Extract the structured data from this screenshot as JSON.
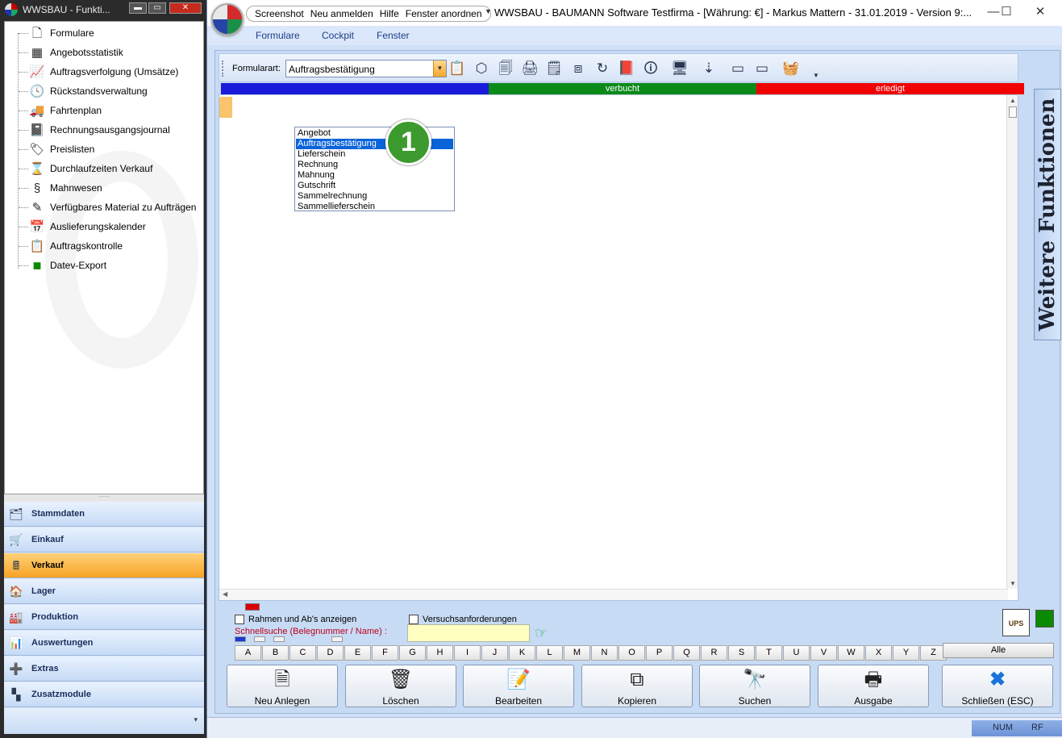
{
  "left_window": {
    "title": "WWSBAU - Funkti...",
    "tree_items": [
      {
        "icon": "document-icon",
        "glyph": "🗋",
        "label": "Formulare"
      },
      {
        "icon": "statistics-table-icon",
        "glyph": "▦",
        "label": "Angebotsstatistik"
      },
      {
        "icon": "sales-chart-icon",
        "glyph": "📈",
        "label": "Auftragsverfolgung (Umsätze)"
      },
      {
        "icon": "clock-back-icon",
        "glyph": "🕓",
        "label": "Rückstandsverwaltung"
      },
      {
        "icon": "truck-icon",
        "glyph": "🚚",
        "label": "Fahrtenplan"
      },
      {
        "icon": "journal-icon",
        "glyph": "📓",
        "label": "Rechnungsausgangsjournal"
      },
      {
        "icon": "price-tag-icon",
        "glyph": "🏷",
        "label": "Preislisten"
      },
      {
        "icon": "hourglass-icon",
        "glyph": "⌛",
        "label": "Durchlaufzeiten Verkauf"
      },
      {
        "icon": "paragraph-icon",
        "glyph": "§",
        "label": "Mahnwesen"
      },
      {
        "icon": "pencil-material-icon",
        "glyph": "✎",
        "label": "Verfügbares Material zu Aufträgen"
      },
      {
        "icon": "calendar-icon",
        "glyph": "📅",
        "label": "Auslieferungskalender"
      },
      {
        "icon": "clipboard-check-icon",
        "glyph": "📋",
        "label": "Auftragskontrolle"
      },
      {
        "icon": "datev-icon",
        "glyph": "■",
        "label": "Datev-Export"
      }
    ],
    "splitter_text": "·····",
    "nav_items": [
      {
        "icon": "master-data-icon",
        "glyph": "🗂",
        "label": "Stammdaten",
        "active": false
      },
      {
        "icon": "cart-icon",
        "glyph": "🛒",
        "label": "Einkauf",
        "active": false
      },
      {
        "icon": "cash-register-icon",
        "glyph": "🖩",
        "label": "Verkauf",
        "active": true
      },
      {
        "icon": "warehouse-icon",
        "glyph": "🏠",
        "label": "Lager",
        "active": false
      },
      {
        "icon": "production-icon",
        "glyph": "🏭",
        "label": "Produktion",
        "active": false
      },
      {
        "icon": "analysis-icon",
        "glyph": "📊",
        "label": "Auswertungen",
        "active": false
      },
      {
        "icon": "extras-icon",
        "glyph": "➕",
        "label": "Extras",
        "active": false
      },
      {
        "icon": "modules-icon",
        "glyph": "▚",
        "label": "Zusatzmodule",
        "active": false
      }
    ],
    "nav_more_glyph": "▾"
  },
  "main_window": {
    "quick_access": [
      "Screenshot",
      "Neu anmelden",
      "Hilfe",
      "Fenster anordnen"
    ],
    "caption": "WWSBAU - BAUMANN Software Testfirma - [Währung: €] -   Markus Mattern - 31.01.2019 - Version 9:...",
    "window_buttons": {
      "minimize": "—",
      "maximize": "☐",
      "close": "✕"
    },
    "menu": [
      "Formulare",
      "Cockpit",
      "Fenster"
    ],
    "toolbar": {
      "label": "Formularart:",
      "selected": "Auftragsbestätigung",
      "icons": [
        "clipboard-icon",
        "box-3d-icon",
        "copy-docs-icon",
        "printer-stack-icon",
        "document-lines-icon",
        "cube-edit-icon",
        "refresh-clock-icon",
        "book-delete-icon",
        "info-doc-icon",
        "monitor-icon",
        "sort-down-icon",
        "page-bottom-icon",
        "page-top-icon",
        "basket-icon"
      ]
    },
    "status_bars": [
      {
        "label": "",
        "color": "#1a1ad8"
      },
      {
        "label": "verbucht",
        "color": "#0b8a1a"
      },
      {
        "label": "erledigt",
        "color": "#f00000"
      }
    ],
    "dropdown_options": [
      "Angebot",
      "Auftragsbestätigung",
      "Lieferschein",
      "Rechnung",
      "Mahnung",
      "Gutschrift",
      "Sammelrechnung",
      "Sammellieferschein"
    ],
    "dropdown_selected_index": 1,
    "badge_number": "1",
    "side_tab": "Weitere Funktionen",
    "checkbox_rahmen": "Rahmen und Ab's anzeigen",
    "checkbox_versuch": "Versuchsanforderungen",
    "search_label": "Schnellsuche (Belegnummer / Name) :",
    "search_value": "",
    "ups_label": "UPS",
    "letters": [
      "A",
      "B",
      "C",
      "D",
      "E",
      "F",
      "G",
      "H",
      "I",
      "J",
      "K",
      "L",
      "M",
      "N",
      "O",
      "P",
      "Q",
      "R",
      "S",
      "T",
      "U",
      "V",
      "W",
      "X",
      "Y",
      "Z"
    ],
    "alle": "Alle",
    "actions": [
      {
        "name": "neu-anlegen-button",
        "icon": "new-document-icon",
        "glyph": "🗎",
        "label": "Neu Anlegen"
      },
      {
        "name": "loeschen-button",
        "icon": "trash-icon",
        "glyph": "🗑",
        "label": "Löschen"
      },
      {
        "name": "bearbeiten-button",
        "icon": "edit-document-icon",
        "glyph": "📝",
        "label": "Bearbeiten"
      },
      {
        "name": "kopieren-button",
        "icon": "copy-icon",
        "glyph": "⧉",
        "label": "Kopieren"
      },
      {
        "name": "suchen-button",
        "icon": "binoculars-icon",
        "glyph": "🔭",
        "label": "Suchen"
      },
      {
        "name": "ausgabe-button",
        "icon": "printer-icon",
        "glyph": "🖶",
        "label": "Ausgabe"
      },
      {
        "name": "schliessen-button",
        "icon": "close-x-icon",
        "glyph": "✖",
        "label": "Schließen (ESC)"
      }
    ],
    "statusbar": {
      "num": "NUM",
      "rf": "RF"
    }
  }
}
